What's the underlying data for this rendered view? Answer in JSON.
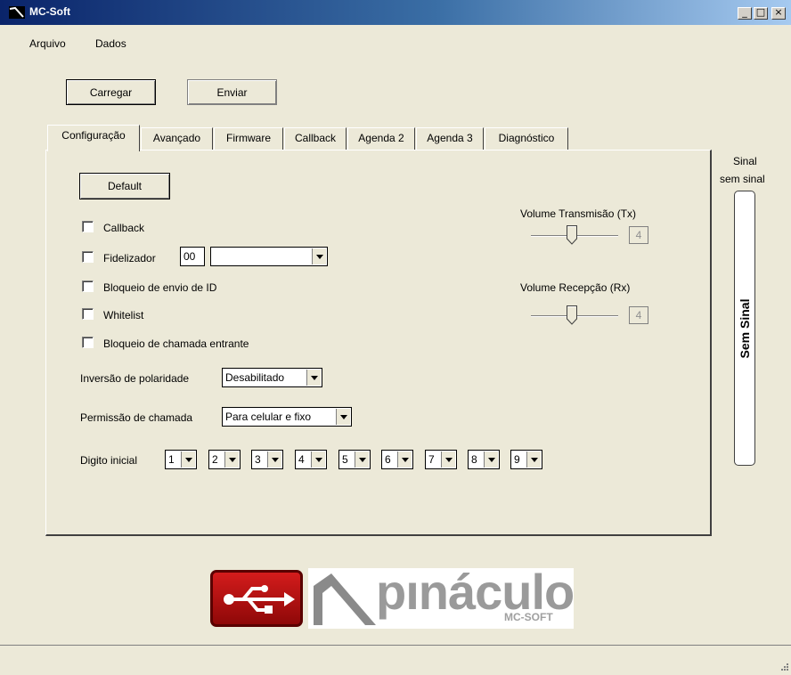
{
  "window": {
    "title": "MC-Soft",
    "minimize_glyph": "_",
    "maximize_glyph": "□",
    "close_glyph": "×"
  },
  "menu": {
    "items": [
      "Arquivo",
      "Dados"
    ]
  },
  "toolbar": {
    "load_label": "Carregar",
    "send_label": "Enviar"
  },
  "tabs": [
    "Configuração",
    "Avançado",
    "Firmware",
    "Callback",
    "Agenda 2",
    "Agenda 3",
    "Diagnóstico"
  ],
  "active_tab": "Configuração",
  "config": {
    "default_label": "Default",
    "callback_label": "Callback",
    "fidelizador_label": "Fidelizador",
    "fidelizador_code": "00",
    "fidelizador_select": "",
    "bloqueio_envio_label": "Bloqueio de envio de ID",
    "whitelist_label": "Whitelist",
    "bloqueio_entrante_label": "Bloqueio de chamada entrante",
    "inversao_label": "Inversão de polaridade",
    "inversao_value": "Desabilitado",
    "permissao_label": "Permissão de chamada",
    "permissao_value": "Para celular e fixo",
    "digito_label": "Digito inicial",
    "digits": [
      "1",
      "2",
      "3",
      "4",
      "5",
      "6",
      "7",
      "8",
      "9"
    ],
    "volume_tx_label": "Volume Transmisão (Tx)",
    "volume_tx_value": "4",
    "volume_rx_label": "Volume Recepção (Rx)",
    "volume_rx_value": "4"
  },
  "signal": {
    "title": "Sinal",
    "status": "sem sinal",
    "bar_text": "Sem Sinal"
  },
  "logos": {
    "brand_text": "pınáculo",
    "brand_sub": "MC-SOFT"
  },
  "colors": {
    "window_bg": "#ece9d8",
    "titlebar": "#0a246a",
    "usb_logo_red": "#c01010"
  }
}
